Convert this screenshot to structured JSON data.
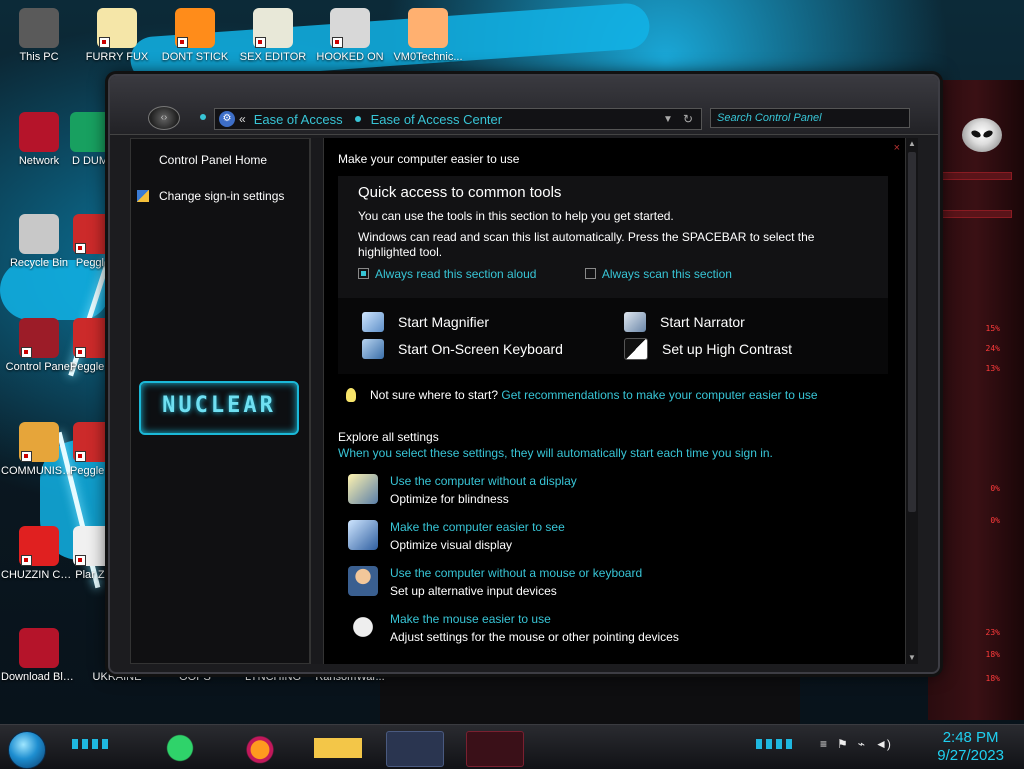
{
  "desktop": {
    "icons": [
      {
        "label": "This PC",
        "color": "#5a5a5a"
      },
      {
        "label": "FURRY FUX",
        "color": "#f5e6a8"
      },
      {
        "label": "DONT STICK",
        "color": "#ff8c1a"
      },
      {
        "label": "SEX EDITOR",
        "color": "#e8e8d8"
      },
      {
        "label": "HOOKED ON",
        "color": "#d8d8d8"
      },
      {
        "label": "VM0Technic...",
        "color": "#ffb070"
      },
      {
        "label": "Network",
        "color": "#b5142a"
      },
      {
        "label": "D DUM",
        "color": "#18a060"
      },
      {
        "label": "Recycle Bin",
        "color": "#c8c8c8"
      },
      {
        "label": "Peggle",
        "color": "#cc2a2a"
      },
      {
        "label": "Control Panel",
        "color": "#9c1c28"
      },
      {
        "label": "Peggle De",
        "color": "#cc2a2a"
      },
      {
        "label": "COMMUNISTS HATE THIS G...",
        "color": "#e6a53a"
      },
      {
        "label": "Peggle of Wa",
        "color": "#cc2a2a"
      },
      {
        "label": "CHUZZIN CUM",
        "color": "#e02020"
      },
      {
        "label": "Plar Zo",
        "color": "#f0f0f0"
      },
      {
        "label": "Download Black Ali...",
        "color": "#b5142a"
      },
      {
        "label": "UKRAINE",
        "color": "#bfbfbf"
      },
      {
        "label": "OOPS",
        "color": "#bfbfbf"
      },
      {
        "label": "LYNCHING",
        "color": "#bfbfbf"
      },
      {
        "label": "RansomWar...",
        "color": "#bfbfbf"
      }
    ]
  },
  "window": {
    "address": {
      "back_glyph": "«",
      "crumbs": [
        "Ease of Access",
        "Ease of Access Center"
      ]
    },
    "search_placeholder": "Search Control Panel",
    "sidebar": {
      "items": [
        "Control Panel Home",
        "Change sign-in settings"
      ],
      "logo_text": "NUCLEAR"
    },
    "main": {
      "heading": "Make your computer easier to use",
      "quick": {
        "title": "Quick access to common tools",
        "line1": "You can use the tools in this section to help you get started.",
        "line2": "Windows can read and scan this list automatically.  Press the SPACEBAR to select the highlighted tool.",
        "check_read": "Always read this section aloud",
        "check_read_checked": true,
        "check_scan": "Always scan this section",
        "check_scan_checked": false
      },
      "tools": [
        "Start Magnifier",
        "Start Narrator",
        "Start On-Screen Keyboard",
        "Set up High Contrast"
      ],
      "tip_prefix": "Not sure where to start?",
      "tip_link": "Get recommendations to make your computer easier to use",
      "explore_title": "Explore all settings",
      "explore_sub": "When you select these settings, they will automatically start each time you sign in.",
      "settings": [
        {
          "title": "Use the computer without a display",
          "desc": "Optimize for blindness"
        },
        {
          "title": "Make the computer easier to see",
          "desc": "Optimize visual display"
        },
        {
          "title": "Use the computer without a mouse or keyboard",
          "desc": "Set up alternative input devices"
        },
        {
          "title": "Make the mouse easier to use",
          "desc": "Adjust settings for the mouse or other pointing devices"
        }
      ]
    }
  },
  "right_panel": {
    "readouts": [
      "15%",
      "24%",
      "13%",
      "0%",
      "0%",
      "23%",
      "18%",
      "18%"
    ]
  },
  "taskbar": {
    "time": "2:48 PM",
    "date": "9/27/2023",
    "accent": "#1fd0f0"
  }
}
